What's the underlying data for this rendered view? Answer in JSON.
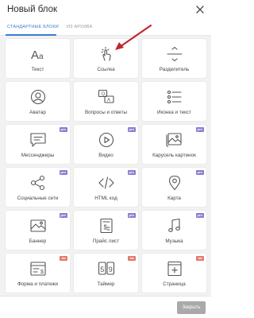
{
  "dialog": {
    "title": "Новый блок"
  },
  "tabs": [
    {
      "label": "Стандартные блоки",
      "active": true
    },
    {
      "label": "Из архива",
      "active": false
    }
  ],
  "blocks": [
    {
      "label": "Текст",
      "icon": "text-aa-icon",
      "badge": null
    },
    {
      "label": "Ссылка",
      "icon": "tap-hand-icon",
      "badge": null
    },
    {
      "label": "Разделитель",
      "icon": "divider-icon",
      "badge": null
    },
    {
      "label": "Аватар",
      "icon": "avatar-icon",
      "badge": null
    },
    {
      "label": "Вопросы и ответы",
      "icon": "qa-icon",
      "badge": null
    },
    {
      "label": "Иконка и текст",
      "icon": "icon-text-list-icon",
      "badge": null
    },
    {
      "label": "Мессенджеры",
      "icon": "messenger-icon",
      "badge": "pro"
    },
    {
      "label": "Видео",
      "icon": "video-play-icon",
      "badge": "pro"
    },
    {
      "label": "Карусель картинок",
      "icon": "image-carousel-icon",
      "badge": "pro"
    },
    {
      "label": "Социальные сети",
      "icon": "share-icon",
      "badge": "pro"
    },
    {
      "label": "HTML код",
      "icon": "code-icon",
      "badge": "pro"
    },
    {
      "label": "Карта",
      "icon": "map-pin-icon",
      "badge": "pro"
    },
    {
      "label": "Баннер",
      "icon": "banner-image-icon",
      "badge": "pro"
    },
    {
      "label": "Прайс лист",
      "icon": "price-list-icon",
      "badge": "pro"
    },
    {
      "label": "Музыка",
      "icon": "music-note-icon",
      "badge": "pro"
    },
    {
      "label": "Форма и платежи",
      "icon": "form-payment-icon",
      "badge": "biz"
    },
    {
      "label": "Таймер",
      "icon": "timer-icon",
      "badge": "biz"
    },
    {
      "label": "Страница",
      "icon": "page-add-icon",
      "badge": "biz"
    }
  ],
  "badge_colors": {
    "pro": "#8c7bd1",
    "biz": "#e2786a"
  },
  "accent": "#3a7bd5",
  "icon_color": "#555555",
  "arrow_color": "#c0272d",
  "footer": {
    "close_label": "Закрыть"
  }
}
